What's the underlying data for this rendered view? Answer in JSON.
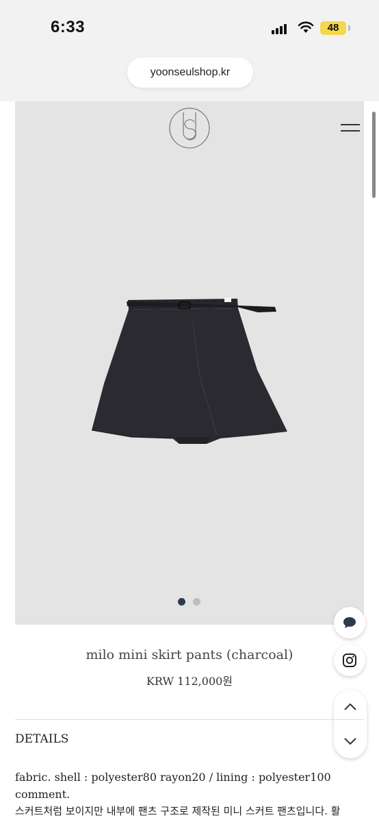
{
  "status_bar": {
    "time": "6:33",
    "battery": "48"
  },
  "browser": {
    "url": "yoonseulshop.kr"
  },
  "carousel": {
    "total": 2,
    "active": 1,
    "active_color": "#2d3b4e",
    "inactive_color": "#bdbdbd"
  },
  "product": {
    "name": "milo mini skirt pants (charcoal)",
    "price": "KRW 112,000원"
  },
  "details": {
    "heading": "DETAILS",
    "fabric": "fabric. shell : polyester80 rayon20 / lining : polyester100",
    "comment_label": "comment.",
    "comment_text": "스커트처럼 보이지만 내부에 팬츠 구조로 제작된 미니 스커트 팬츠입니다. 활"
  },
  "icons": {
    "menu": "hamburger-menu-icon",
    "chat": "chat-bubble-icon",
    "instagram": "instagram-icon",
    "up": "chevron-up-icon",
    "down": "chevron-down-icon"
  },
  "colors": {
    "hero_bg": "#e4e4e4",
    "garment": "#2b2a31"
  }
}
